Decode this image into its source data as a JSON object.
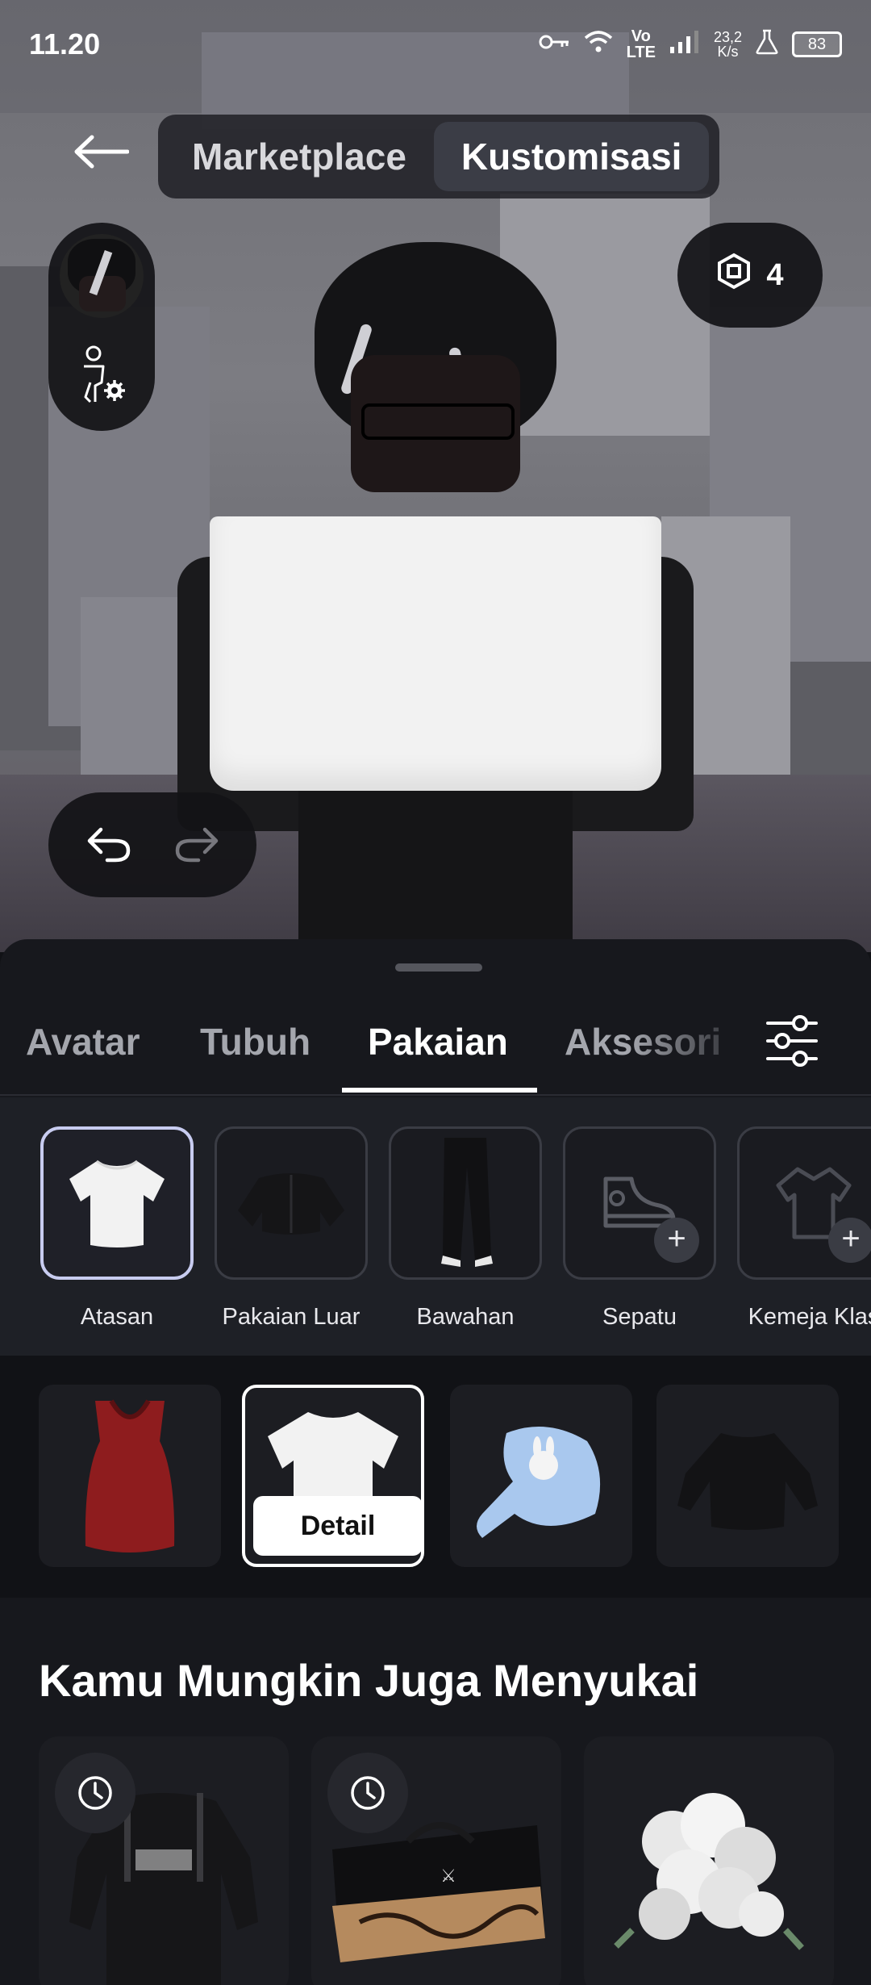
{
  "status_bar": {
    "time": "11.20",
    "network_type_top": "Vo",
    "network_type_bottom": "LTE",
    "speed_value": "23,2",
    "speed_unit": "K/s",
    "battery": "83"
  },
  "header": {
    "tabs": [
      {
        "label": "Marketplace",
        "active": false
      },
      {
        "label": "Kustomisasi",
        "active": true
      }
    ]
  },
  "currency": {
    "amount": "4",
    "icon": "robux-icon"
  },
  "editor_tabs": [
    {
      "label": "Avatar",
      "active": false
    },
    {
      "label": "Tubuh",
      "active": false
    },
    {
      "label": "Pakaian",
      "active": true
    },
    {
      "label": "Aksesori",
      "active": false
    }
  ],
  "categories": [
    {
      "label": "Atasan",
      "selected": true
    },
    {
      "label": "Pakaian Luar",
      "selected": false
    },
    {
      "label": "Bawahan",
      "selected": false
    },
    {
      "label": "Sepatu",
      "selected": false
    },
    {
      "label": "Kemeja Klas",
      "selected": false
    }
  ],
  "items": {
    "detail_label": "Detail",
    "selected_index": 1
  },
  "recommendations": {
    "title": "Kamu Mungkin Juga Menyukai"
  },
  "colors": {
    "sheet_bg": "#17181d",
    "selected_border": "#c8ccf0",
    "accent_white": "#ffffff"
  }
}
